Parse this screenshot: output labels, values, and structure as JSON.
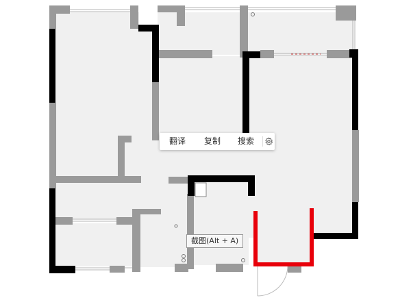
{
  "context_toolbar": {
    "translate_label": "翻译",
    "copy_label": "复制",
    "search_label": "搜索",
    "settings_icon": "gear-icon"
  },
  "screenshot_tooltip": {
    "label": "截图(Alt + A)"
  },
  "colors": {
    "wall_thick": "#000000",
    "wall_thin": "#9a9a9a",
    "room_fill": "#f0f0f0",
    "highlight": "#e8000a"
  }
}
